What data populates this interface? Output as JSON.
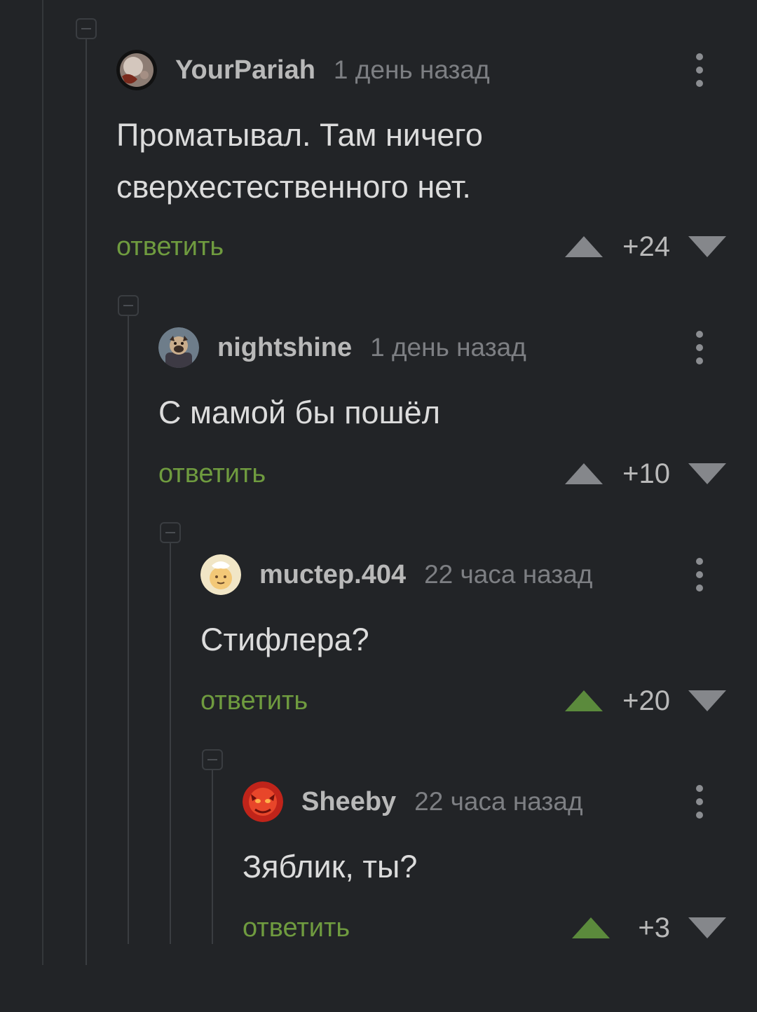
{
  "comments": [
    {
      "username": "YourPariah",
      "time": "1 день назад",
      "text": "Проматывал. Там ничего сверхестественного нет.",
      "reply_label": "ответить",
      "score": "+24",
      "upvoted": false
    },
    {
      "username": "nightshine",
      "time": "1 день назад",
      "text": "С мамой бы пошёл",
      "reply_label": "ответить",
      "score": "+10",
      "upvoted": false
    },
    {
      "username": "muctep.404",
      "time": "22 часа назад",
      "text": "Стифлера?",
      "reply_label": "ответить",
      "score": "+20",
      "upvoted": true
    },
    {
      "username": "Sheeby",
      "time": "22 часа назад",
      "text": "Зяблик, ты?",
      "reply_label": "ответить",
      "score": "+3",
      "upvoted": true
    }
  ],
  "colors": {
    "background": "#222427",
    "reply": "#6f9b3f",
    "upvote_active": "#5b8a3c",
    "vote_inactive": "#85878b"
  }
}
